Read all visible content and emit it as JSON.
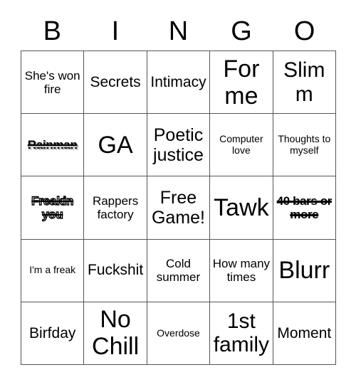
{
  "card": {
    "header_letters": [
      "B",
      "I",
      "N",
      "G",
      "O"
    ],
    "grid_size": "5x5",
    "colors": {
      "background": "#ffffff",
      "text": "#000000",
      "grid_line": "#555555",
      "mark_shadow": "#b5b5b5"
    },
    "rows": [
      [
        {
          "text": "She's won fire",
          "size": "sm",
          "mark": "none"
        },
        {
          "text": "Secrets",
          "size": "md",
          "mark": "none"
        },
        {
          "text": "Intimacy",
          "size": "md",
          "mark": "none"
        },
        {
          "text": "For me",
          "size": "xxl",
          "mark": "none"
        },
        {
          "text": "Slimm",
          "size": "xl",
          "mark": "none"
        }
      ],
      [
        {
          "text": "Rainman",
          "size": "sm",
          "mark": "bold-strike"
        },
        {
          "text": "GA",
          "size": "xxl",
          "mark": "none"
        },
        {
          "text": "Poetic justice",
          "size": "lg",
          "mark": "none"
        },
        {
          "text": "Computer love",
          "size": "xs",
          "mark": "none"
        },
        {
          "text": "Thoughts to myself",
          "size": "xs",
          "mark": "none"
        }
      ],
      [
        {
          "text": "Freakin you",
          "size": "sm",
          "mark": "outline-strike"
        },
        {
          "text": "Rappers factory",
          "size": "sm",
          "mark": "none"
        },
        {
          "text": "Free Game!",
          "size": "lg",
          "mark": "none"
        },
        {
          "text": "Tawk",
          "size": "xxl",
          "mark": "none"
        },
        {
          "text": "40 bars or more",
          "size": "sm",
          "mark": "bold-strike-solid"
        }
      ],
      [
        {
          "text": "I'm a freak",
          "size": "xs",
          "mark": "none"
        },
        {
          "text": "Fuckshit",
          "size": "md",
          "mark": "none"
        },
        {
          "text": "Cold summer",
          "size": "sm",
          "mark": "none"
        },
        {
          "text": "How many times",
          "size": "sm",
          "mark": "none"
        },
        {
          "text": "Blurr",
          "size": "xxl",
          "mark": "none"
        }
      ],
      [
        {
          "text": "Birfday",
          "size": "md",
          "mark": "none"
        },
        {
          "text": "No Chill",
          "size": "xxl",
          "mark": "none"
        },
        {
          "text": "Overdose",
          "size": "xs",
          "mark": "none"
        },
        {
          "text": "1st family",
          "size": "xl",
          "mark": "none"
        },
        {
          "text": "Moment",
          "size": "md",
          "mark": "none"
        }
      ]
    ]
  }
}
